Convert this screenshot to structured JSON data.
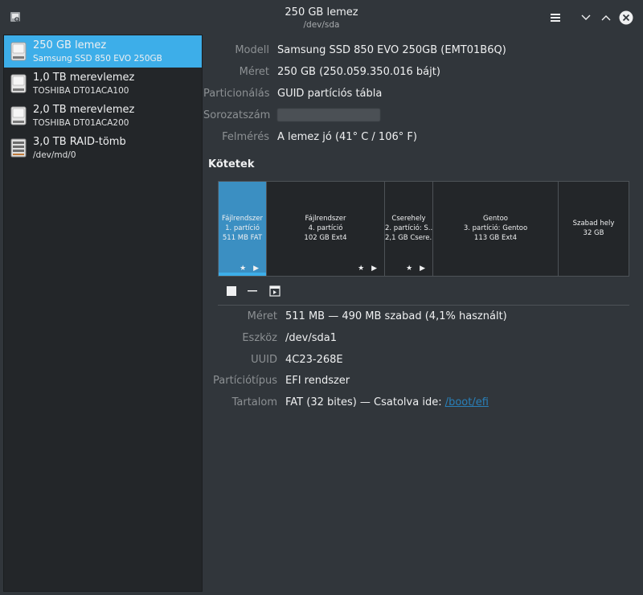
{
  "window": {
    "title": "250 GB lemez",
    "subtitle": "/dev/sda"
  },
  "sidebar": {
    "items": [
      {
        "name": "250 GB lemez",
        "sub": "Samsung SSD 850 EVO 250GB",
        "icon": "drive-icon",
        "selected": true
      },
      {
        "name": "1,0 TB merevlemez",
        "sub": "TOSHIBA DT01ACA100",
        "icon": "drive-icon",
        "selected": false
      },
      {
        "name": "2,0 TB merevlemez",
        "sub": "TOSHIBA DT01ACA200",
        "icon": "drive-icon",
        "selected": false
      },
      {
        "name": "3,0 TB RAID-tömb",
        "sub": "/dev/md/0",
        "icon": "raid-icon",
        "selected": false
      }
    ]
  },
  "drive": {
    "rows": [
      {
        "label": "Modell",
        "value": "Samsung SSD 850 EVO 250GB (EMT01B6Q)"
      },
      {
        "label": "Méret",
        "value": "250 GB (250.059.350.016 bájt)"
      },
      {
        "label": "Particionálás",
        "value": "GUID partíciós tábla"
      },
      {
        "label": "Sorozatszám",
        "value": ""
      },
      {
        "label": "Felmérés",
        "value": "A lemez jó (41° C / 106° F)"
      }
    ]
  },
  "volumes_title": "Kötetek",
  "volumes": [
    {
      "line1": "Fájlrendszer",
      "line2": "1. partíció",
      "line3": "511 MB FAT",
      "flags": "★ ▶",
      "selected": true
    },
    {
      "line1": "Fájlrendszer",
      "line2": "4. partíció",
      "line3": "102 GB Ext4",
      "flags": "★ ▶",
      "selected": false
    },
    {
      "line1": "Cserehely",
      "line2": "2. partíció: S...",
      "line3": "2,1 GB Csere...",
      "flags": "★ ▶",
      "selected": false
    },
    {
      "line1": "Gentoo",
      "line2": "3. partíció: Gentoo",
      "line3": "113 GB Ext4",
      "flags": "",
      "selected": false
    },
    {
      "line1": "Szabad hely",
      "line2": "32 GB",
      "line3": "",
      "flags": "",
      "selected": false
    }
  ],
  "partition": {
    "rows": [
      {
        "label": "Méret",
        "value": "511 MB — 490 MB szabad (4,1% használt)"
      },
      {
        "label": "Eszköz",
        "value": "/dev/sda1"
      },
      {
        "label": "UUID",
        "value": "4C23-268E"
      },
      {
        "label": "Partíciótípus",
        "value": "EFI rendszer"
      },
      {
        "label": "Tartalom",
        "value": "FAT (32 bites) — Csatolva ide: ",
        "link": "/boot/efi"
      }
    ]
  },
  "colors": {
    "accent": "#3daee9",
    "background": "#31363b",
    "sidebar": "#232629"
  }
}
